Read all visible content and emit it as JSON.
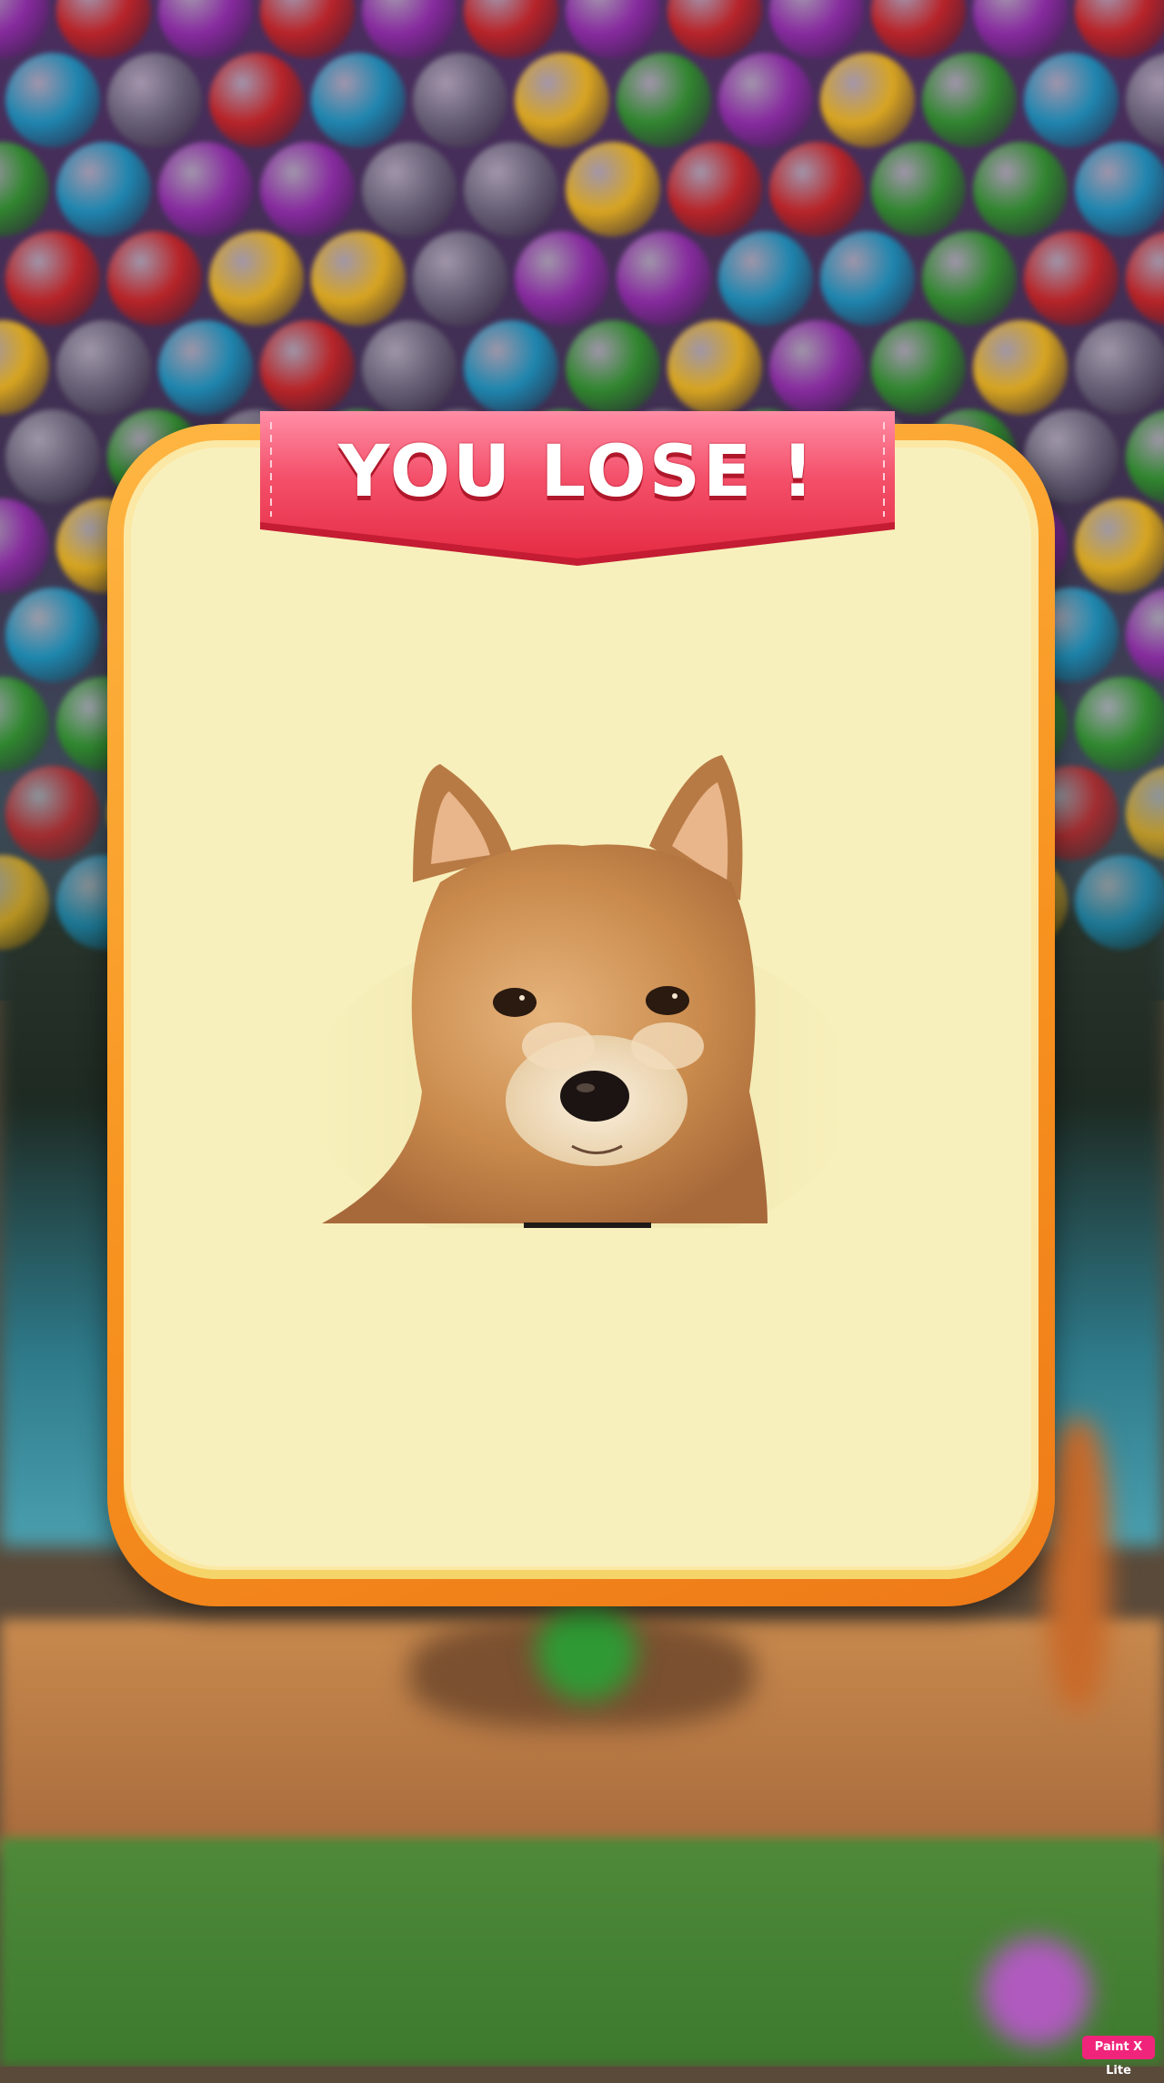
{
  "dialog": {
    "title": "YOU LOSE !"
  },
  "watermark": {
    "label": "Paint X Lite"
  },
  "colors": {
    "card_border": "#f7921f",
    "card_face": "#f8f0bc",
    "ribbon": "#f03a56",
    "ribbon_text": "#ffffff",
    "watermark_bg": "#f0247a"
  },
  "bubble_palette": [
    "#8e2aa6",
    "#1a8fb8",
    "#2e8f2a",
    "#c42222",
    "#e8b21a",
    "#6a6478"
  ]
}
